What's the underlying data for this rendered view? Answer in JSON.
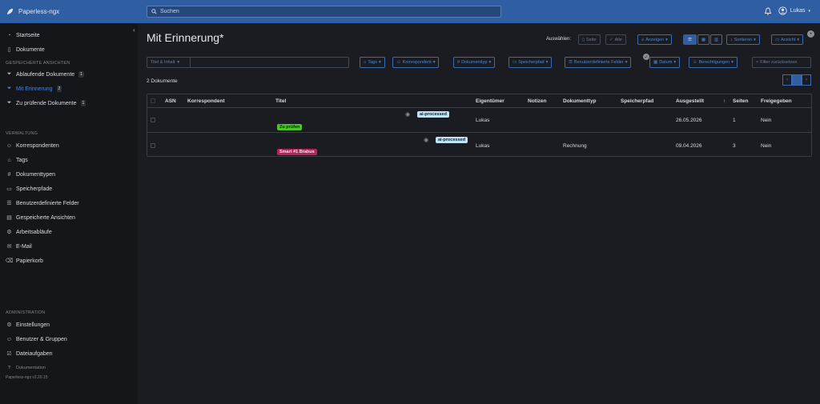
{
  "app": {
    "title": "Paperless-ngx"
  },
  "search": {
    "placeholder": "Suchen"
  },
  "user": {
    "name": "Lukas"
  },
  "sidebar": {
    "top": [
      {
        "label": "Startseite",
        "icon": "speedometer-icon"
      },
      {
        "label": "Dokumente",
        "icon": "document-icon"
      }
    ],
    "saved_heading": "GESPEICHERTE ANSICHTEN",
    "saved": [
      {
        "label": "Ablaufende Dokumente",
        "badge": "1"
      },
      {
        "label": "Mit Erinnerung",
        "badge": "2"
      },
      {
        "label": "Zu prüfende Dokumente",
        "badge": "1"
      }
    ],
    "admin_heading": "VERWALTUNG",
    "admin": [
      {
        "label": "Korrespondenten"
      },
      {
        "label": "Tags"
      },
      {
        "label": "Dokumenttypen"
      },
      {
        "label": "Speicherpfade"
      },
      {
        "label": "Benutzerdefinierte Felder"
      },
      {
        "label": "Gespeicherte Ansichten"
      },
      {
        "label": "Arbeitsabläufe"
      },
      {
        "label": "E-Mail"
      },
      {
        "label": "Papierkorb"
      }
    ],
    "admin2_heading": "ADMINISTRATION",
    "admin2": [
      {
        "label": "Einstellungen"
      },
      {
        "label": "Benutzer & Gruppen"
      },
      {
        "label": "Dateiaufgaben"
      }
    ],
    "docs_link": "Dokumentation",
    "version": "Paperless-ngx v2.20.15"
  },
  "page": {
    "title": "Mit Erinnerung*",
    "select_label": "Auswählen:",
    "btn_seite": "Seite",
    "btn_alle": "Alle",
    "btn_anzeigen": "Anzeigen",
    "btn_sortieren": "Sortieren",
    "btn_ansicht": "Ansicht",
    "filter_select": "Titel & Inhalt",
    "filters": [
      "Tags",
      "Korrespondent",
      "Dokumenttyp",
      "Speicherpfad",
      "Benutzerdefinierte Felder",
      "Datum",
      "Berechtigungen"
    ],
    "reset_filter": "Filter zurücksetzen",
    "count": "2 Dokumente",
    "page_num": "1"
  },
  "table": {
    "headers": [
      "ASN",
      "Korrespondent",
      "Titel",
      "Eigentümer",
      "Notizen",
      "Dokumenttyp",
      "Speicherpfad",
      "Ausgestellt",
      "Seiten",
      "Freigegeben"
    ],
    "rows": [
      {
        "title_tag": "ai-processed",
        "tag": "Zu prüfen",
        "tag_color": "#4fc22c",
        "owner": "Lukas",
        "doctype": "",
        "date": "26.05.2026",
        "pages": "1",
        "shared": "Nein"
      },
      {
        "title_tag": "ai-processed",
        "tag": "Smart #1 Brabus",
        "tag_color": "#b8235a",
        "owner": "Lukas",
        "doctype": "Rechnung",
        "date": "09.04.2026",
        "pages": "3",
        "shared": "Nein"
      }
    ]
  },
  "colors": {
    "accent": "#2f5fa2",
    "background": "#1b1c22",
    "sidebar": "#15161a"
  }
}
